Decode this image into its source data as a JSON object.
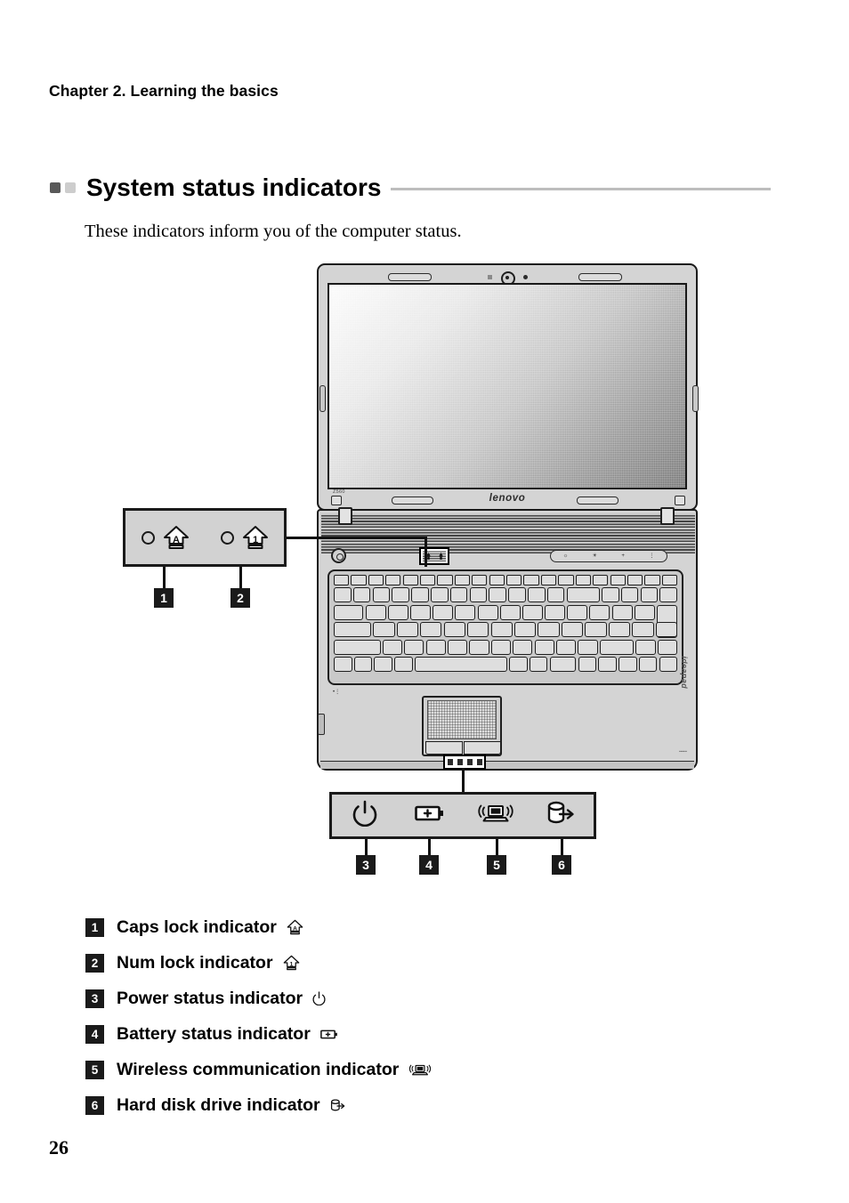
{
  "document": {
    "chapter_header": "Chapter 2. Learning the basics",
    "section_title": "System status indicators",
    "intro_text": "These indicators inform you of the computer status.",
    "page_number": "26",
    "rule_color": "#bdbdbd",
    "bullet_colors": {
      "dark": "#595959",
      "light": "#cdcdcd"
    }
  },
  "figure": {
    "device_brand": "lenovo",
    "device_model": "Z560",
    "device_family": "ideapad",
    "callout_top": {
      "items": [
        {
          "number": "1",
          "icon": "caps-lock-icon"
        },
        {
          "number": "2",
          "icon": "num-lock-icon"
        }
      ]
    },
    "callout_bottom": {
      "items": [
        {
          "number": "3",
          "icon": "power-icon"
        },
        {
          "number": "4",
          "icon": "battery-icon"
        },
        {
          "number": "5",
          "icon": "wireless-icon"
        },
        {
          "number": "6",
          "icon": "hard-disk-icon"
        }
      ]
    },
    "touch_strip_icons": [
      "brightness-down-icon",
      "brightness-up-icon",
      "volume-up-icon",
      "info-icon"
    ]
  },
  "legend": {
    "items": [
      {
        "number": "1",
        "label": "Caps lock indicator",
        "icon": "caps-lock-icon"
      },
      {
        "number": "2",
        "label": "Num lock indicator",
        "icon": "num-lock-icon"
      },
      {
        "number": "3",
        "label": "Power status indicator",
        "icon": "power-icon"
      },
      {
        "number": "4",
        "label": "Battery status indicator",
        "icon": "battery-icon"
      },
      {
        "number": "5",
        "label": "Wireless communication indicator",
        "icon": "wireless-icon"
      },
      {
        "number": "6",
        "label": "Hard disk drive indicator",
        "icon": "hard-disk-icon"
      }
    ]
  }
}
